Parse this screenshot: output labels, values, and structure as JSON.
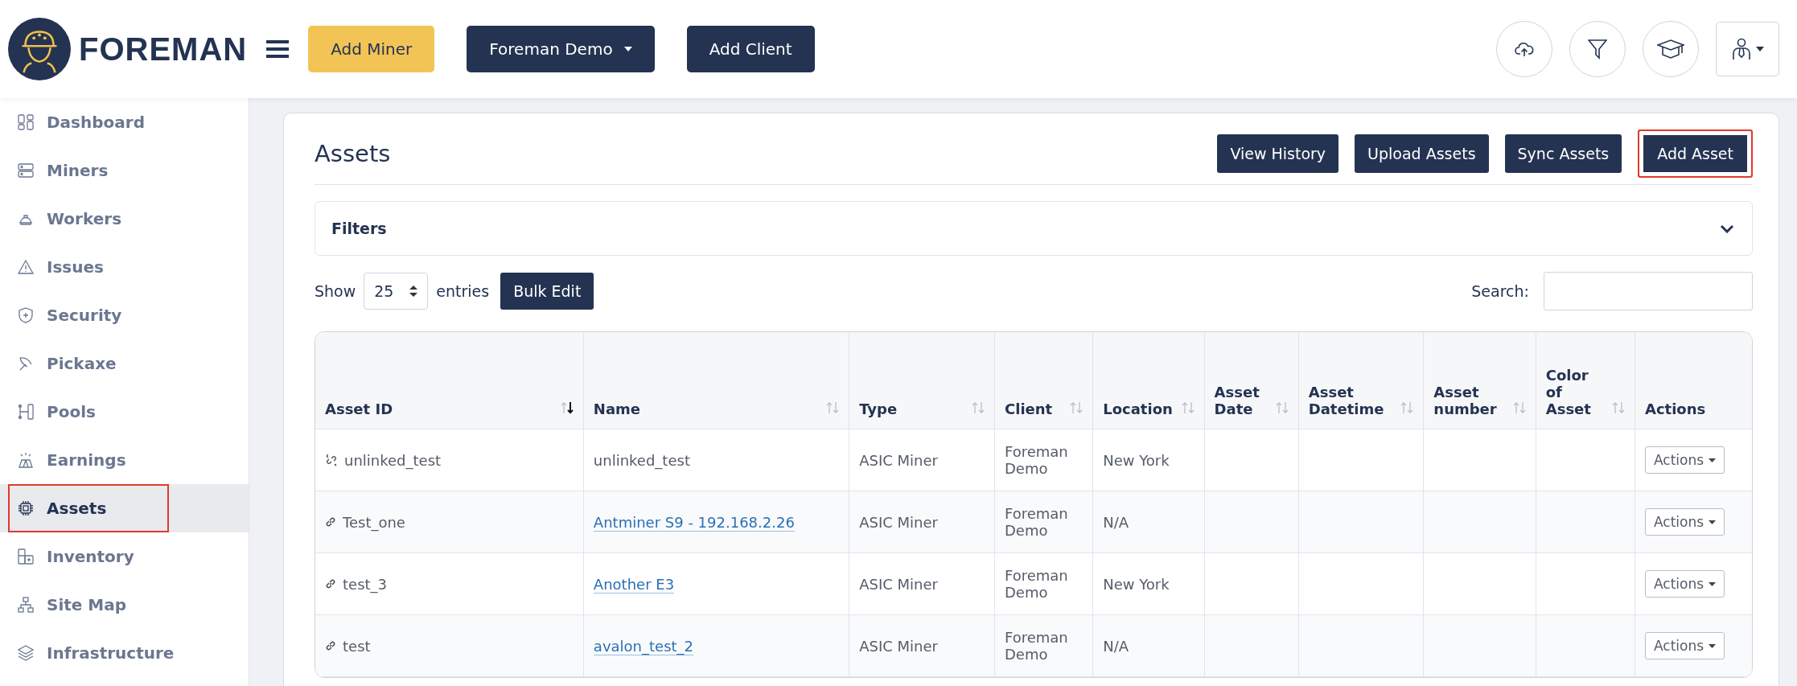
{
  "header": {
    "brand": "FOREMAN",
    "buttons": [
      {
        "label": "Add Miner",
        "kind": "accent"
      },
      {
        "label": "Foreman Demo",
        "kind": "dropdown"
      },
      {
        "label": "Add Client",
        "kind": "primary"
      }
    ]
  },
  "sidebar": {
    "items": [
      {
        "label": "Dashboard",
        "selected": false,
        "highlighted": false
      },
      {
        "label": "Miners",
        "selected": false,
        "highlighted": false
      },
      {
        "label": "Workers",
        "selected": false,
        "highlighted": false
      },
      {
        "label": "Issues",
        "selected": false,
        "highlighted": false
      },
      {
        "label": "Security",
        "selected": false,
        "highlighted": false
      },
      {
        "label": "Pickaxe",
        "selected": false,
        "highlighted": false
      },
      {
        "label": "Pools",
        "selected": false,
        "highlighted": false
      },
      {
        "label": "Earnings",
        "selected": false,
        "highlighted": false
      },
      {
        "label": "Assets",
        "selected": true,
        "highlighted": true
      },
      {
        "label": "Inventory",
        "selected": false,
        "highlighted": false
      },
      {
        "label": "Site Map",
        "selected": false,
        "highlighted": false
      },
      {
        "label": "Infrastructure",
        "selected": false,
        "highlighted": false
      }
    ]
  },
  "page": {
    "title": "Assets",
    "buttons": [
      {
        "label": "View History",
        "highlighted": false
      },
      {
        "label": "Upload Assets",
        "highlighted": false
      },
      {
        "label": "Sync Assets",
        "highlighted": false
      },
      {
        "label": "Add Asset",
        "highlighted": true
      }
    ],
    "filters": {
      "label": "Filters",
      "expanded": false
    },
    "show_label": "Show",
    "page_size": "25",
    "entries_label": "entries",
    "bulk_edit": "Bulk Edit",
    "search_label": "Search:"
  },
  "table": {
    "columns": [
      {
        "label": "Asset ID",
        "sortable": true,
        "sorted": true
      },
      {
        "label": "Name",
        "sortable": true,
        "sorted": false
      },
      {
        "label": "Type",
        "sortable": true,
        "sorted": false
      },
      {
        "label": "Client",
        "sortable": true,
        "sorted": false
      },
      {
        "label": "Location",
        "sortable": true,
        "sorted": false
      },
      {
        "label": "Asset Date",
        "sortable": true,
        "sorted": false
      },
      {
        "label": "Asset Datetime",
        "sortable": true,
        "sorted": false
      },
      {
        "label": "Asset number",
        "sortable": true,
        "sorted": false
      },
      {
        "label": "Color of Asset",
        "sortable": true,
        "sorted": false
      },
      {
        "label": "Actions",
        "sortable": false
      }
    ],
    "rows": [
      {
        "asset_id": "unlinked_test",
        "linked": false,
        "name": "unlinked_test",
        "type": "ASIC Miner",
        "client": "Foreman Demo",
        "location": "New York",
        "action": "Actions"
      },
      {
        "asset_id": "Test_one",
        "linked": true,
        "name": "Antminer S9 - 192.168.2.26",
        "type": "ASIC Miner",
        "client": "Foreman Demo",
        "location": "N/A",
        "action": "Actions"
      },
      {
        "asset_id": "test_3",
        "linked": true,
        "name": "Another E3",
        "type": "ASIC Miner",
        "client": "Foreman Demo",
        "location": "New York",
        "action": "Actions"
      },
      {
        "asset_id": "test",
        "linked": true,
        "name": "avalon_test_2",
        "type": "ASIC Miner",
        "client": "Foreman Demo",
        "location": "N/A",
        "action": "Actions"
      }
    ]
  }
}
